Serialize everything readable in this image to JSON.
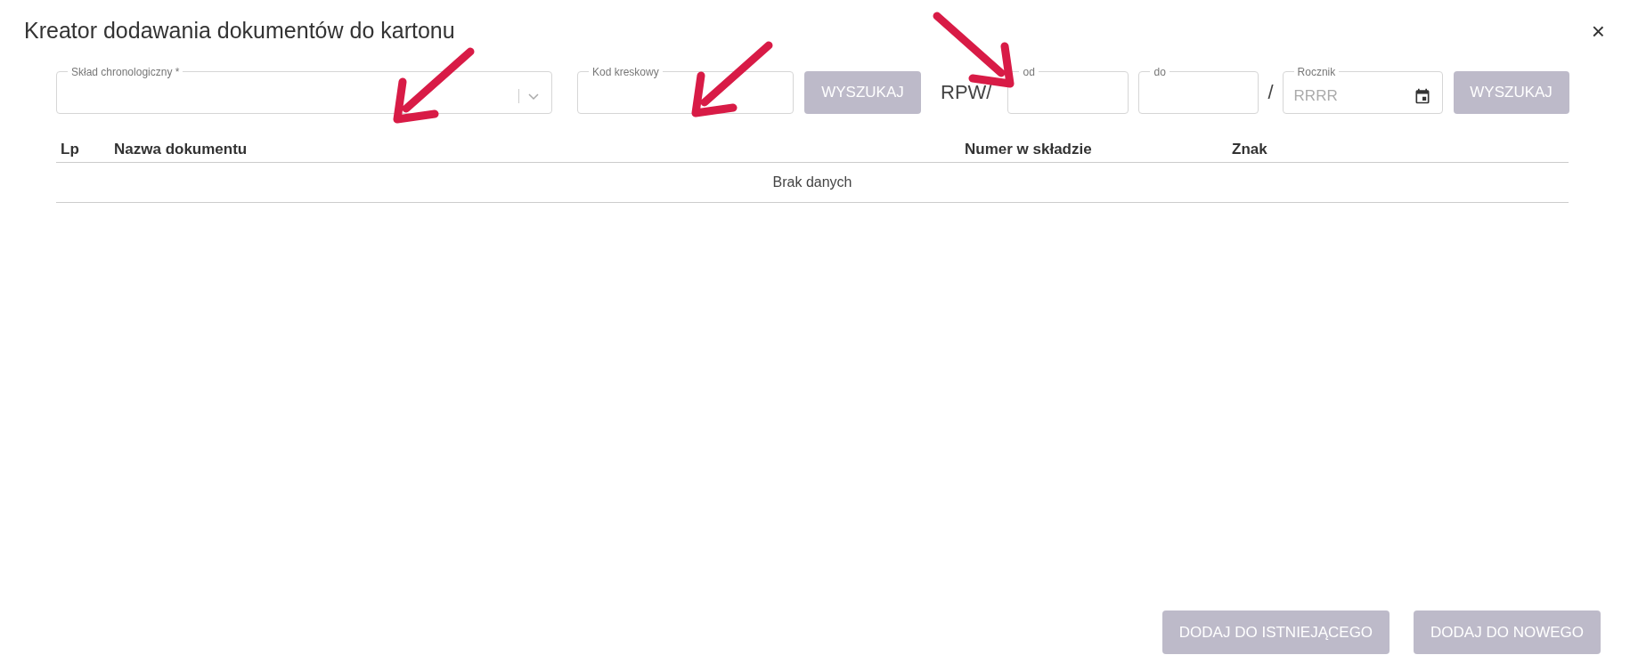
{
  "dialog": {
    "title": "Kreator dodawania dokumentów do kartonu",
    "close": "×"
  },
  "search_chronological": {
    "label": "Skład chronologiczny *"
  },
  "search_barcode": {
    "label": "Kod kreskowy",
    "button": {
      "label": "WYSZUKAJ",
      "disabled": true
    }
  },
  "search_rpw": {
    "prefix": "RPW/",
    "from": {
      "label": "od"
    },
    "to": {
      "label": "do"
    },
    "separator": "/",
    "year": {
      "label": "Rocznik",
      "placeholder": "RRRR"
    },
    "button": {
      "label": "WYSZUKAJ",
      "disabled": true
    }
  },
  "table": {
    "columns": [
      "Lp",
      "Nazwa dokumentu",
      "Numer w składzie",
      "Znak"
    ],
    "empty_text": "Brak danych"
  },
  "footer_buttons": [
    {
      "label": "DODAJ DO ISTNIEJĄCEGO",
      "disabled": true
    },
    {
      "label": "DODAJ DO NOWEGO",
      "disabled": true
    }
  ]
}
